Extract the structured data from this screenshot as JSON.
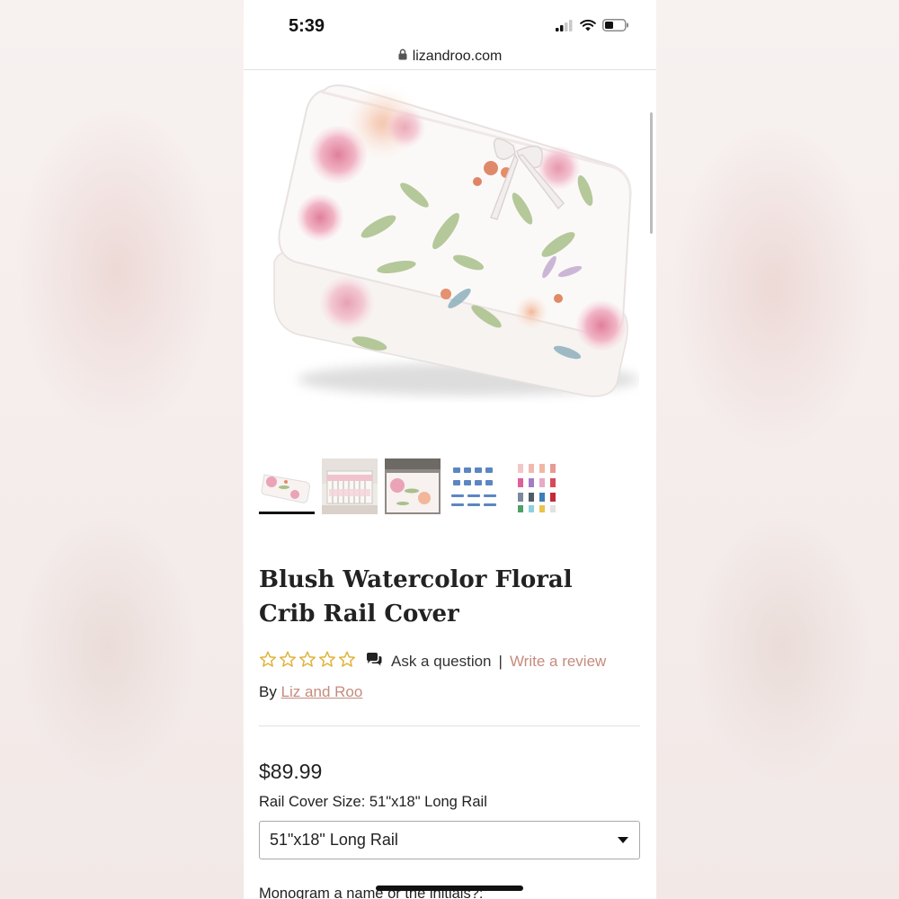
{
  "status_bar": {
    "time": "5:39"
  },
  "browser": {
    "url": "lizandroo.com"
  },
  "product": {
    "title": "Blush Watercolor Floral Crib Rail Cover",
    "rating_stars": 0,
    "rating_max": 5,
    "ask_question": "Ask a question",
    "separator": "|",
    "write_review": "Write a review",
    "by_prefix": "By",
    "brand": "Liz and Roo",
    "price": "$89.99",
    "size_label": "Rail Cover Size:",
    "size_value": "51\"x18\" Long Rail",
    "size_select_value": "51\"x18\" Long Rail",
    "monogram_label": "Monogram a name or the initials?:"
  },
  "thumbnails": [
    {
      "name": "folded-rail-cover",
      "active": true
    },
    {
      "name": "crib-with-rail-cover",
      "active": false
    },
    {
      "name": "rail-cover-on-crib-closeup",
      "active": false
    },
    {
      "name": "monogram-styles",
      "active": false
    },
    {
      "name": "thread-colors",
      "active": false
    }
  ],
  "colors": {
    "link_accent": "#c58b7e",
    "star_color": "#e0b23a",
    "text": "#222222"
  }
}
